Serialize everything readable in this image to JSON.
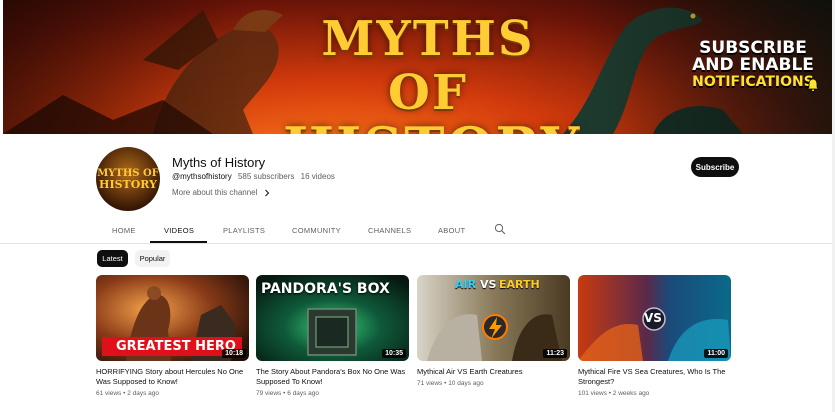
{
  "banner": {
    "title_line1": "MYTHS OF",
    "title_line2": "HISTORY",
    "cta_line1": "SUBSCRIBE",
    "cta_line2": "AND ENABLE",
    "cta_line3": "NOTIFICATIONS"
  },
  "channel": {
    "avatar_line1": "MYTHS OF",
    "avatar_line2": "HISTORY",
    "name": "Myths of History",
    "handle": "@mythsofhistory",
    "subscribers": "585 subscribers",
    "videos": "16 videos",
    "more_about": "More about this channel",
    "subscribe_label": "Subscribe"
  },
  "tabs": [
    {
      "label": "HOME",
      "active": false
    },
    {
      "label": "VIDEOS",
      "active": true
    },
    {
      "label": "PLAYLISTS",
      "active": false
    },
    {
      "label": "COMMUNITY",
      "active": false
    },
    {
      "label": "CHANNELS",
      "active": false
    },
    {
      "label": "ABOUT",
      "active": false
    }
  ],
  "filters": {
    "latest": "Latest",
    "popular": "Popular",
    "selected": "Latest"
  },
  "videos": [
    {
      "thumb_text": "GREATEST HERO",
      "duration": "10:18",
      "title": "HORRIFYING Story about Hercules No One Was Supposed to Know!",
      "views": "61 views",
      "age": "2 days ago"
    },
    {
      "thumb_text": "PANDORA'S BOX",
      "duration": "10:35",
      "title": "The Story About Pandora's Box No One Was Supposed To Know!",
      "views": "79 views",
      "age": "6 days ago"
    },
    {
      "thumb_text_a": "AIR",
      "thumb_text_vs": "VS",
      "thumb_text_b": "EARTH",
      "duration": "11:23",
      "title": "Mythical Air VS Earth Creatures",
      "views": "71 views",
      "age": "10 days ago"
    },
    {
      "thumb_text_vs": "VS",
      "duration": "11:00",
      "title": "Mythical Fire VS Sea Creatures, Who Is The Strongest?",
      "views": "101 views",
      "age": "2 weeks ago"
    }
  ],
  "colors": {
    "accent": "#0f0f0f",
    "secondary_text": "#606060",
    "banner_gold": "#ffcc33"
  },
  "icons": [
    "chevron-right-icon",
    "search-icon",
    "bell-icon"
  ]
}
